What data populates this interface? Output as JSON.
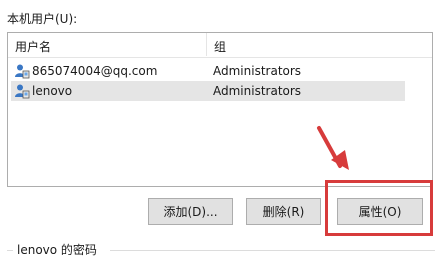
{
  "section_label": "本机用户(U):",
  "table": {
    "columns": [
      "用户名",
      "组"
    ],
    "rows": [
      {
        "user": "865074004@qq.com",
        "group": "Administrators",
        "selected": false
      },
      {
        "user": "lenovo",
        "group": "Administrators",
        "selected": true
      }
    ]
  },
  "buttons": {
    "add": "添加(D)...",
    "remove": "删除(R)",
    "properties": "属性(O)"
  },
  "password_group_label": "lenovo 的密码",
  "colors": {
    "annotation": "#d73b3b",
    "selection": "#e5e5e5",
    "button_face": "#e1e1e1"
  },
  "icons": [
    "user-account-icon"
  ]
}
